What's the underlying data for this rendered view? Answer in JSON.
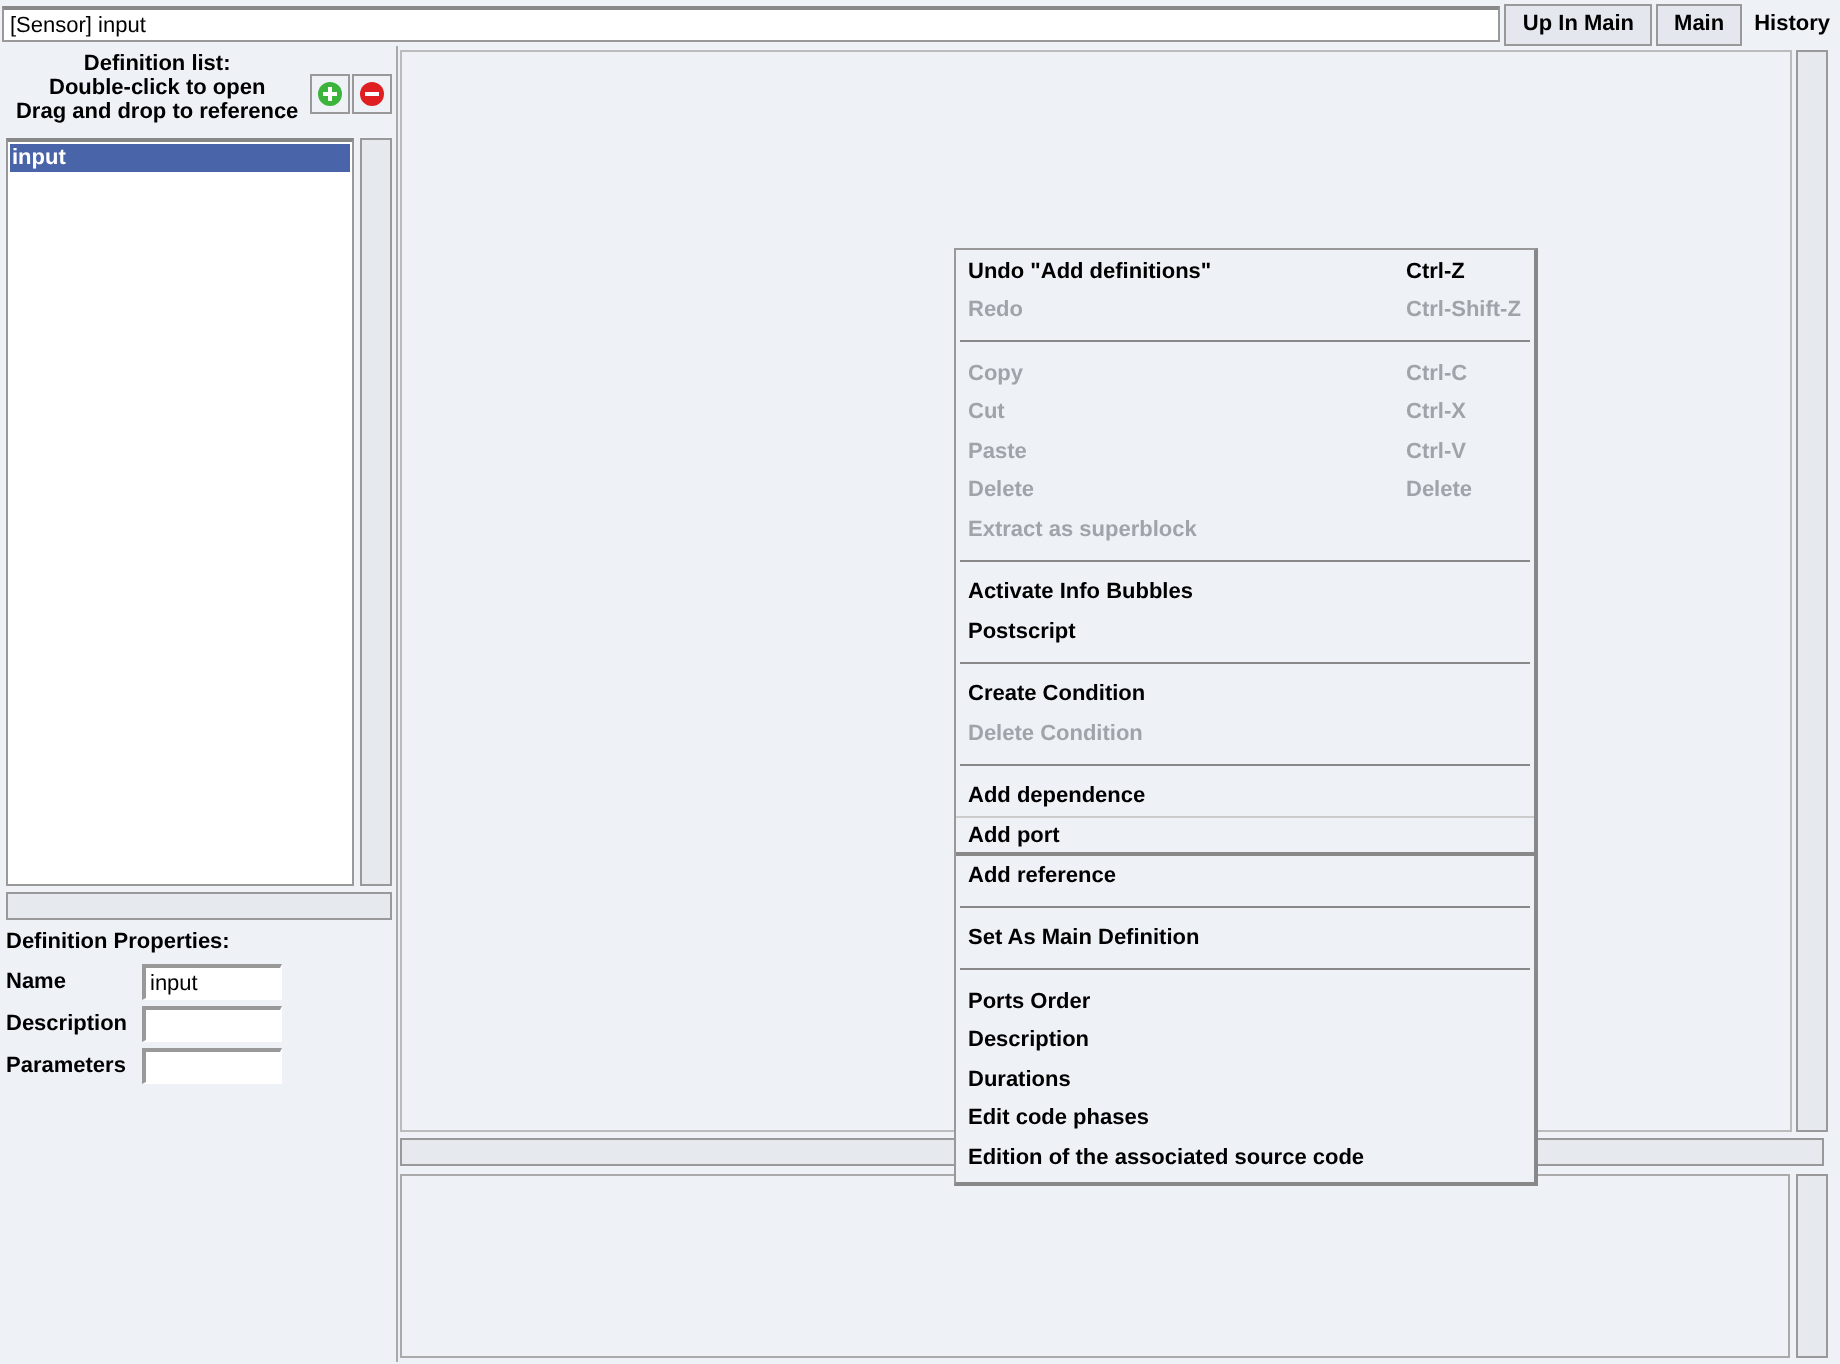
{
  "path_field": {
    "value": "[Sensor] input"
  },
  "nav_buttons": [
    "Up In Main",
    "Main",
    "History"
  ],
  "definition_list": {
    "header": [
      "Definition list:",
      "Double-click to open",
      "Drag and drop to reference"
    ],
    "items": [
      {
        "label": "input",
        "selected": true
      }
    ]
  },
  "properties": {
    "title": "Definition Properties:",
    "fields": [
      {
        "label": "Name",
        "value": "input"
      },
      {
        "label": "Description"
      },
      {
        "label": "Parameters"
      }
    ]
  },
  "context_menu": [
    {
      "kind": "item",
      "label": "Undo \"Add definitions\"",
      "shortcut": "Ctrl-Z",
      "disabled": false,
      "selected": false
    },
    {
      "kind": "item",
      "label": "Redo",
      "shortcut": "Ctrl-Shift-Z",
      "disabled": true,
      "selected": false
    },
    {
      "kind": "separator"
    },
    {
      "kind": "item",
      "label": "Copy",
      "shortcut": "Ctrl-C",
      "disabled": true,
      "selected": false
    },
    {
      "kind": "item",
      "label": "Cut",
      "shortcut": "Ctrl-X",
      "disabled": true,
      "selected": false
    },
    {
      "kind": "item",
      "label": "Paste",
      "shortcut": "Ctrl-V",
      "disabled": true,
      "selected": false
    },
    {
      "kind": "item",
      "label": "Delete",
      "shortcut": "Delete",
      "disabled": true,
      "selected": false
    },
    {
      "kind": "item",
      "label": "Extract as superblock",
      "disabled": true,
      "selected": false
    },
    {
      "kind": "separator"
    },
    {
      "kind": "item",
      "label": "Activate Info Bubbles",
      "disabled": false,
      "selected": false
    },
    {
      "kind": "item",
      "label": "Postscript",
      "disabled": false,
      "selected": false
    },
    {
      "kind": "separator"
    },
    {
      "kind": "item",
      "label": "Create Condition",
      "disabled": false,
      "selected": false
    },
    {
      "kind": "item",
      "label": "Delete Condition",
      "disabled": true,
      "selected": false
    },
    {
      "kind": "separator"
    },
    {
      "kind": "item",
      "label": "Add dependence",
      "disabled": false,
      "selected": false
    },
    {
      "kind": "item",
      "label": "Add port",
      "disabled": false,
      "selected": true
    },
    {
      "kind": "item",
      "label": "Add reference",
      "disabled": false,
      "selected": false
    },
    {
      "kind": "separator"
    },
    {
      "kind": "item",
      "label": "Set As Main Definition",
      "disabled": false,
      "selected": false
    },
    {
      "kind": "separator"
    },
    {
      "kind": "item",
      "label": "Ports Order",
      "disabled": false,
      "selected": false
    },
    {
      "kind": "item",
      "label": "Description",
      "disabled": false,
      "selected": false
    },
    {
      "kind": "item",
      "label": "Durations",
      "disabled": false,
      "selected": false
    },
    {
      "kind": "item",
      "label": "Edit code phases",
      "disabled": false,
      "selected": false
    },
    {
      "kind": "item",
      "label": "Edition of the associated source code",
      "disabled": false,
      "selected": false
    }
  ]
}
